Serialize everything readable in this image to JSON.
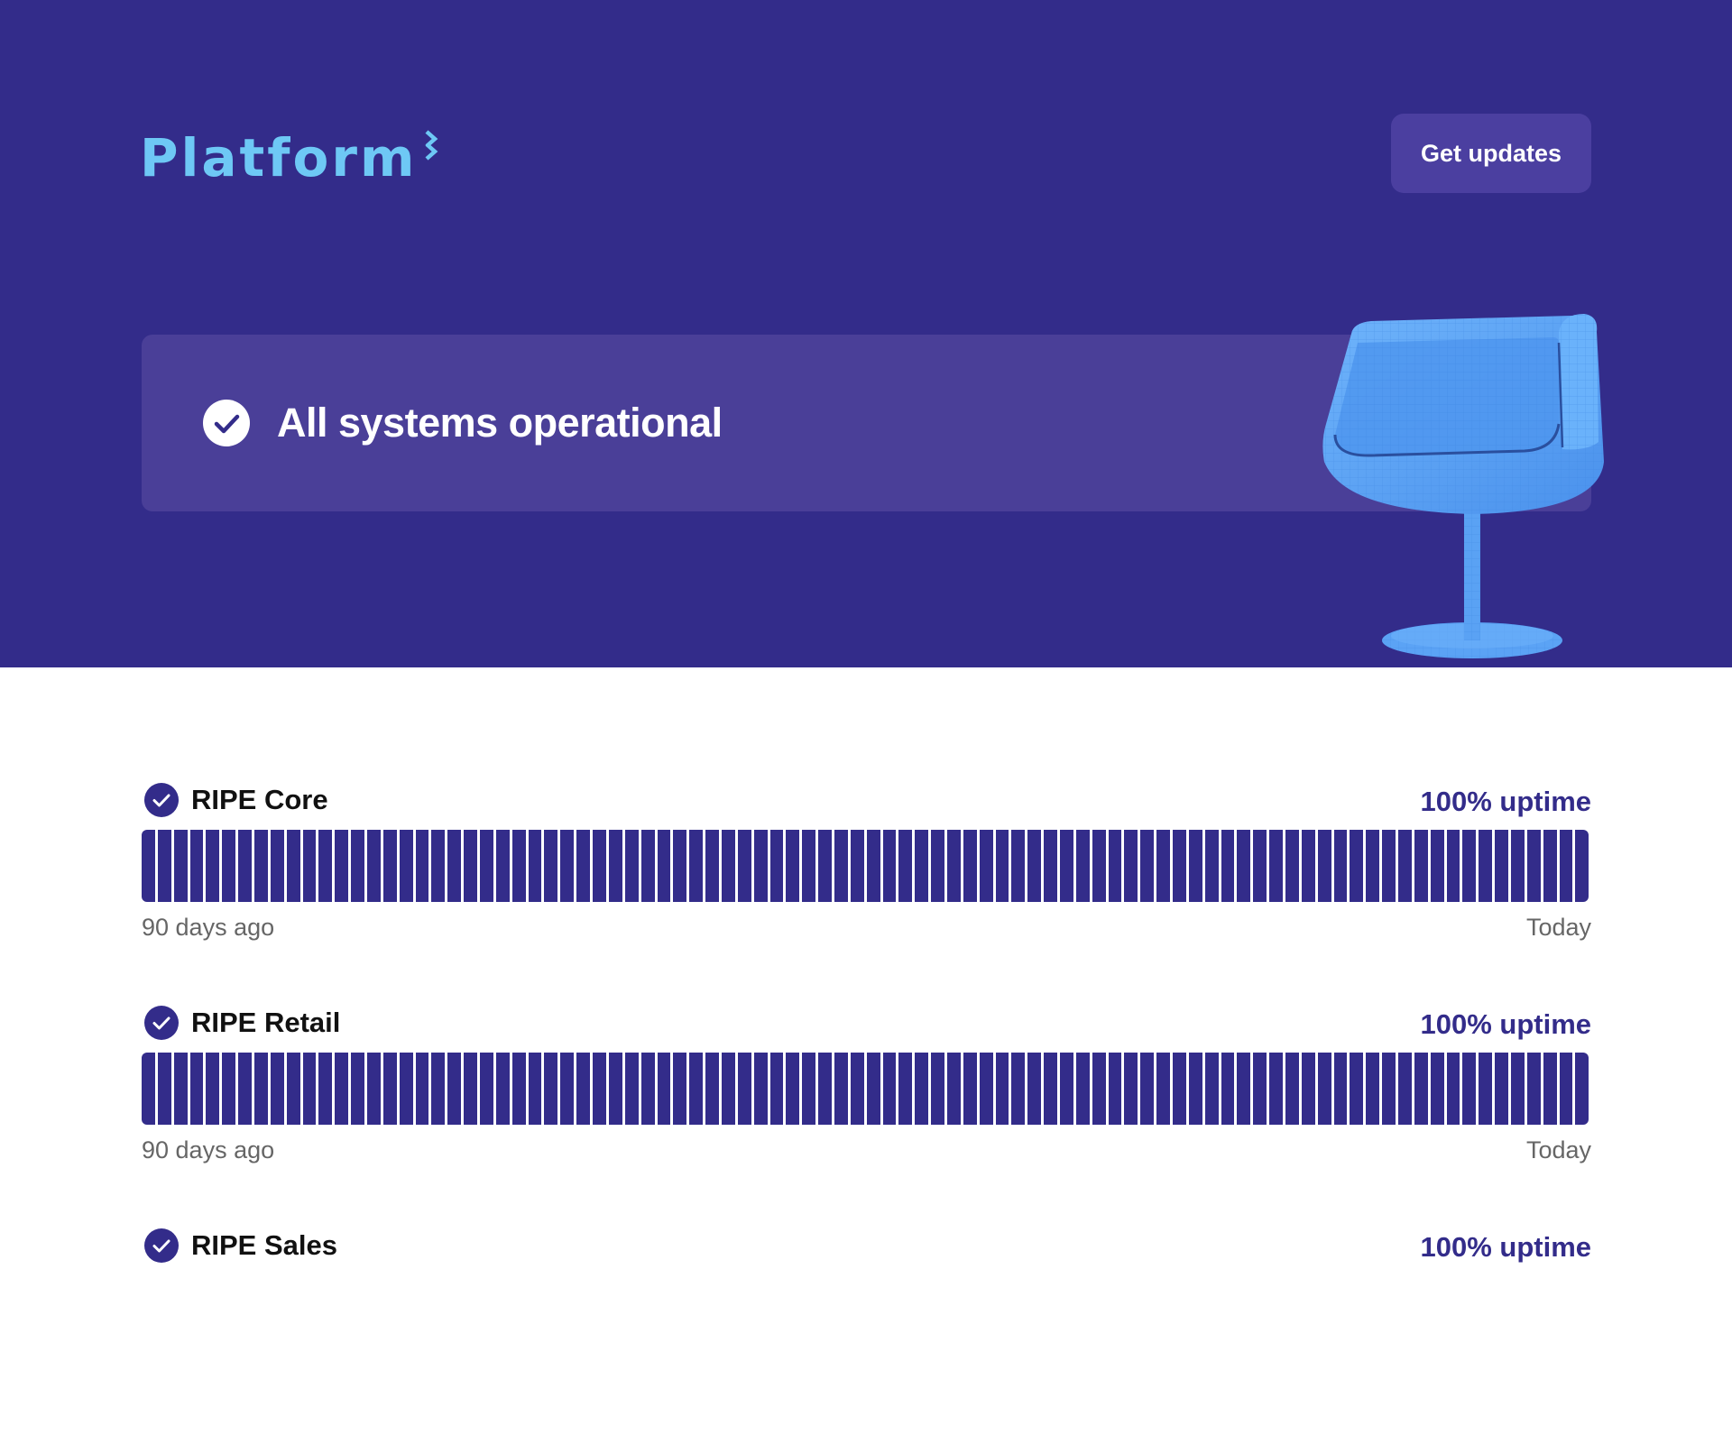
{
  "brand": {
    "logo_text": "Platform",
    "logo_icon": "logo-chevrons-icon"
  },
  "header": {
    "updates_button": "Get updates"
  },
  "status": {
    "message": "All systems operational",
    "icon": "check-circle-icon"
  },
  "colors": {
    "hero_bg": "#332c8a",
    "banner_bg": "#4a3f98",
    "button_bg": "#4b3fa0",
    "logo": "#6ec8f5",
    "uptime_bar": "#332c8a",
    "chair": "#5ba3f5"
  },
  "components": [
    {
      "name": "RIPE Core",
      "uptime": "100% uptime",
      "range_start": "90 days ago",
      "range_end": "Today",
      "days_operational": 90
    },
    {
      "name": "RIPE Retail",
      "uptime": "100% uptime",
      "range_start": "90 days ago",
      "range_end": "Today",
      "days_operational": 90
    },
    {
      "name": "RIPE Sales",
      "uptime": "100% uptime"
    }
  ]
}
